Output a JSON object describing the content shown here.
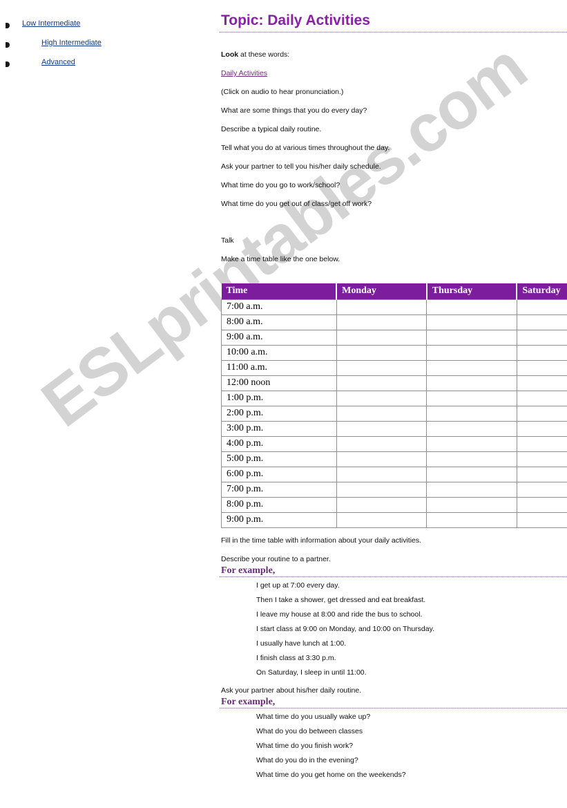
{
  "sidebar": {
    "items": [
      {
        "label": "Low Intermediate",
        "indent": 1
      },
      {
        "label": "High Intermediate",
        "indent": 2
      },
      {
        "label": "Advanced",
        "indent": 2
      }
    ]
  },
  "main": {
    "title": "Topic: Daily Activities",
    "look_bold": "Look",
    "look_rest": " at these words:",
    "audio_link": "Daily Activities",
    "audio_note": "(Click on audio to hear pronunciation.)",
    "prompts": [
      "What are some things that you do every day?",
      "Describe a typical daily routine.",
      "Tell what you do at various times throughout the day.",
      "Ask your partner to tell you his/her daily schedule.",
      "What time do you go to work/school?",
      "What time do you get out of class/get off work?"
    ],
    "talk_heading": "Talk",
    "talk_instruction": "Make a time table like the one below.",
    "after_table": [
      "Fill in the time table with information about your daily activities.",
      "Describe your routine to a partner."
    ],
    "for_example_1": "For example,",
    "example_routine": [
      "I get up at 7:00 every day.",
      "Then I take a shower, get dressed and eat breakfast.",
      "I leave my house at 8:00 and ride the bus to school.",
      "I start class at 9:00 on Monday, and 10:00 on Thursday.",
      "I usually have lunch at 1:00.",
      "I finish class at 3:30 p.m.",
      "On Saturday, I sleep in until 11:00."
    ],
    "ask_partner": "Ask your partner about his/her daily routine.",
    "for_example_2": "For example,",
    "example_questions": [
      "What time do you usually wake up?",
      "What do you do between classes",
      "What time do you finish work?",
      "What do you do in the evening?",
      "What time do you get home on the weekends?"
    ]
  },
  "schedule": {
    "headers": [
      "Time",
      "Monday",
      "Thursday",
      "Saturday"
    ],
    "rows": [
      "7:00 a.m.",
      "8:00 a.m.",
      "9:00 a.m.",
      "10:00 a.m.",
      "11:00 a.m.",
      "12:00 noon",
      "1:00 p.m.",
      "2:00 p.m.",
      "3:00 p.m.",
      "4:00 p.m.",
      "5:00 p.m.",
      "6:00 p.m.",
      "7:00 p.m.",
      "8:00 p.m.",
      "9:00 p.m."
    ]
  },
  "watermark": {
    "text": "ESLprintables.com"
  },
  "colors": {
    "title_purple": "#8c1fa8",
    "header_purple": "#7c1d9e",
    "link_blue": "#123a8c",
    "link_purple": "#6b2c7a",
    "watermark_gray": "#cccccc"
  }
}
